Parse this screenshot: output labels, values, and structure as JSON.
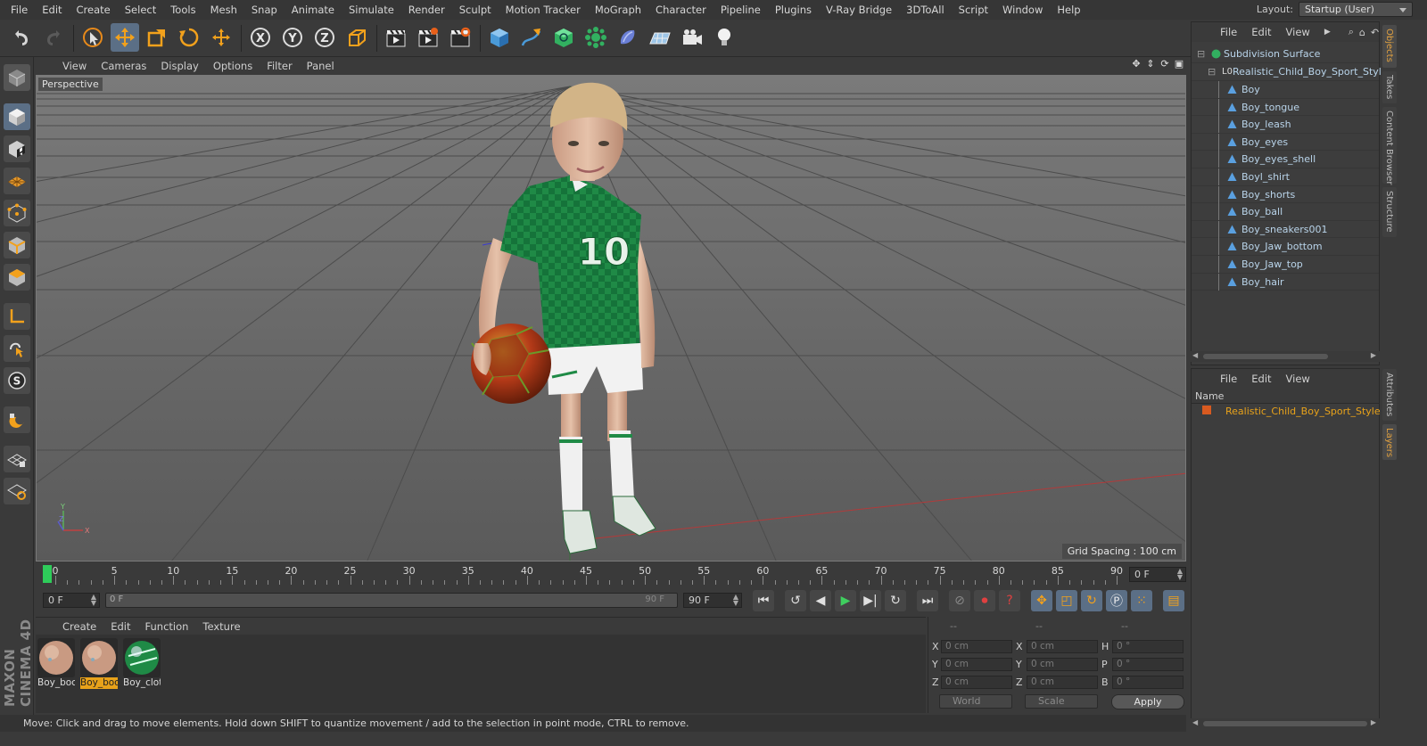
{
  "menubar": {
    "items": [
      "File",
      "Edit",
      "Create",
      "Select",
      "Tools",
      "Mesh",
      "Snap",
      "Animate",
      "Simulate",
      "Render",
      "Sculpt",
      "Motion Tracker",
      "MoGraph",
      "Character",
      "Pipeline",
      "Plugins",
      "V-Ray Bridge",
      "3DToAll",
      "Script",
      "Window",
      "Help"
    ],
    "layout_label": "Layout:",
    "layout_value": "Startup (User)"
  },
  "viewport": {
    "menu": [
      "View",
      "Cameras",
      "Display",
      "Options",
      "Filter",
      "Panel"
    ],
    "camera_label": "Perspective",
    "grid_spacing": "Grid Spacing : 100 cm",
    "jersey_number": "10",
    "axis_labels": {
      "x": "X",
      "y": "Y",
      "z": "Z"
    }
  },
  "timeline": {
    "tick_labels": [
      "0",
      "5",
      "10",
      "15",
      "20",
      "25",
      "30",
      "35",
      "40",
      "45",
      "50",
      "55",
      "60",
      "65",
      "70",
      "75",
      "80",
      "85",
      "90"
    ],
    "frame_end_field": "0 F",
    "current_frame": "0 F",
    "range_start": "0 F",
    "range_end": "90 F",
    "max_field": "90 F"
  },
  "material_manager": {
    "menu": [
      "Create",
      "Edit",
      "Function",
      "Texture"
    ],
    "materials": [
      {
        "label": "Boy_boc",
        "selected": false,
        "kind": "skin"
      },
      {
        "label": "Boy_boc",
        "selected": true,
        "kind": "skin"
      },
      {
        "label": "Boy_clot",
        "selected": false,
        "kind": "cloth"
      }
    ]
  },
  "coordinates": {
    "header": [
      "--",
      "--",
      "--"
    ],
    "rows": [
      {
        "a": "X",
        "av": "0 cm",
        "b": "X",
        "bv": "0 cm",
        "c": "H",
        "cv": "0 °"
      },
      {
        "a": "Y",
        "av": "0 cm",
        "b": "Y",
        "bv": "0 cm",
        "c": "P",
        "cv": "0 °"
      },
      {
        "a": "Z",
        "av": "0 cm",
        "b": "Z",
        "bv": "0 cm",
        "c": "B",
        "cv": "0 °"
      }
    ],
    "mode": "World",
    "scale": "Scale",
    "apply_label": "Apply"
  },
  "status": "Move: Click and drag to move elements. Hold down SHIFT to quantize movement / add to the selection in point mode, CTRL to remove.",
  "objects": {
    "menu": [
      "File",
      "Edit",
      "View"
    ],
    "root": "Subdivision Surface",
    "group": "Realistic_Child_Boy_Sport_Style",
    "children": [
      "Boy",
      "Boy_tongue",
      "Boy_leash",
      "Boy_eyes",
      "Boy_eyes_shell",
      "Boyl_shirt",
      "Boy_shorts",
      "Boy_ball",
      "Boy_sneakers001",
      "Boy_Jaw_bottom",
      "Boy_Jaw_top",
      "Boy_hair"
    ]
  },
  "layers": {
    "menu": [
      "File",
      "Edit",
      "View"
    ],
    "column": "Name",
    "items": [
      "Realistic_Child_Boy_Sport_Style"
    ]
  },
  "side_tabs": [
    "Objects",
    "Takes",
    "Content Browser",
    "Structure",
    "Attributes",
    "Layers"
  ],
  "colors": {
    "accent": "#e8a21a",
    "selection": "#5b6f86",
    "object_text": "#b9d4ea",
    "layer_text": "#e8a21a",
    "jersey": "#1e8a45"
  }
}
